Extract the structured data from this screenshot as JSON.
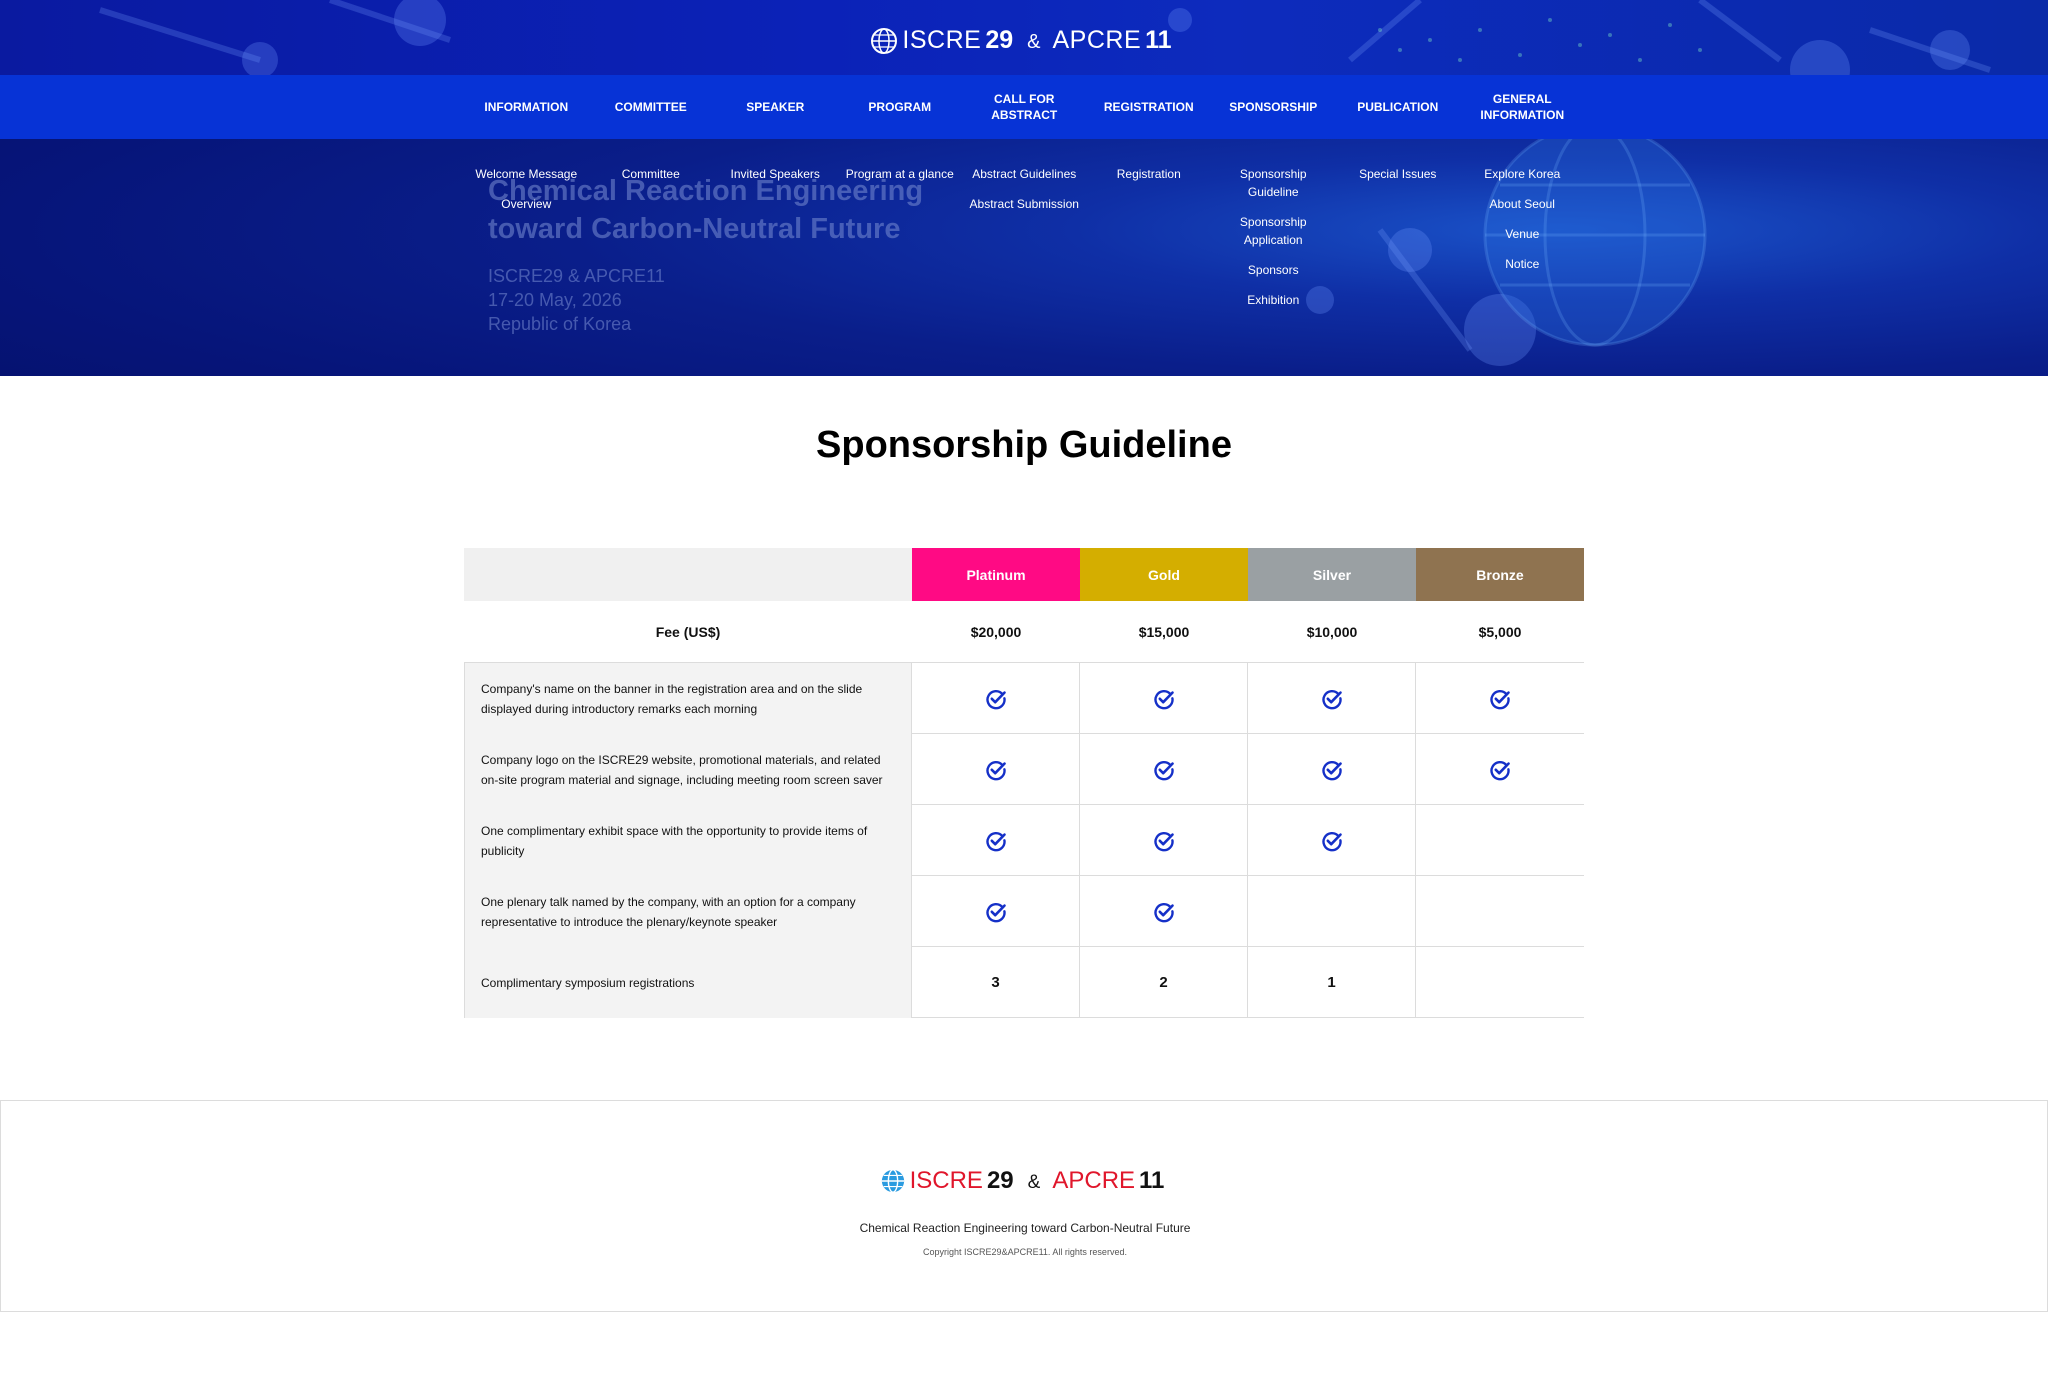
{
  "logo": {
    "name1": "ISCRE",
    "num1": "29",
    "amp": "&",
    "name2": "APCRE",
    "num2": "11"
  },
  "nav": [
    {
      "label": "INFORMATION",
      "sub": [
        "Welcome Message",
        "Overview"
      ]
    },
    {
      "label": "COMMITTEE",
      "sub": [
        "Committee"
      ]
    },
    {
      "label": "SPEAKER",
      "sub": [
        "Invited Speakers"
      ]
    },
    {
      "label": "PROGRAM",
      "sub": [
        "Program at a glance"
      ]
    },
    {
      "label": "CALL FOR ABSTRACT",
      "sub": [
        "Abstract Guidelines",
        "Abstract Submission"
      ]
    },
    {
      "label": "REGISTRATION",
      "sub": [
        "Registration"
      ]
    },
    {
      "label": "SPONSORSHIP",
      "sub": [
        "Sponsorship Guideline",
        "Sponsorship Application",
        "Sponsors",
        "Exhibition"
      ]
    },
    {
      "label": "PUBLICATION",
      "sub": [
        "Special Issues"
      ]
    },
    {
      "label": "GENERAL INFORMATION",
      "sub": [
        "Explore Korea",
        "About Seoul",
        "Venue",
        "Notice"
      ]
    }
  ],
  "hero": {
    "line1": "Chemical Reaction Engineering",
    "line2": "toward Carbon-Neutral Future",
    "info1": "ISCRE29 & APCRE11",
    "info2": "17-20 May, 2026",
    "info3": "Republic of Korea"
  },
  "page_title": "Sponsorship Guideline",
  "table": {
    "tiers": [
      {
        "name": "Platinum",
        "color": "#ff0a84"
      },
      {
        "name": "Gold",
        "color": "#d4ae00"
      },
      {
        "name": "Silver",
        "color": "#9aa0a3"
      },
      {
        "name": "Bronze",
        "color": "#8f7350"
      }
    ],
    "fee_label": "Fee (US$)",
    "fees": [
      "$20,000",
      "$15,000",
      "$10,000",
      "$5,000"
    ],
    "rows": [
      {
        "label": "Company's name on the banner in the registration area and on the slide displayed during introductory remarks each morning",
        "cells": [
          "check",
          "check",
          "check",
          "check"
        ]
      },
      {
        "label": "Company logo on the ISCRE29 website, promotional materials, and related on-site program material and signage, including meeting room screen saver",
        "cells": [
          "check",
          "check",
          "check",
          "check"
        ]
      },
      {
        "label": "One complimentary exhibit space with the opportunity to provide items of publicity",
        "cells": [
          "check",
          "check",
          "check",
          ""
        ]
      },
      {
        "label": "One plenary talk named by the company, with an option for a company representative to introduce the plenary/keynote speaker",
        "cells": [
          "check",
          "check",
          "",
          ""
        ]
      },
      {
        "label": "Complimentary symposium registrations",
        "cells": [
          "3",
          "2",
          "1",
          ""
        ]
      }
    ],
    "check_color": "#1530c8"
  },
  "footer": {
    "tagline": "Chemical Reaction Engineering toward Carbon-Neutral Future",
    "copyright": "Copyright ISCRE29&APCRE11. All rights reserved."
  }
}
